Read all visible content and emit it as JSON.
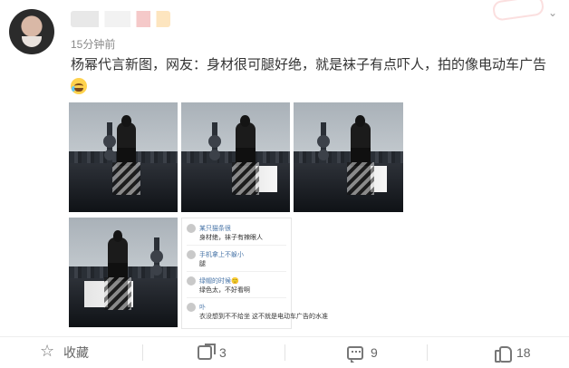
{
  "post": {
    "time": "15分钟前",
    "text": "杨幂代言新图，网友：身材很可腿好绝，就是袜子有点吓人，拍的像电动车广告",
    "images_count": 5,
    "comment_screenshot": {
      "rows": [
        {
          "name": "某只猫条很",
          "text": "身材绝，袜子有辣眼人"
        },
        {
          "name": "手机拿上不躲小",
          "text": "腿"
        },
        {
          "name": "绿帽的时候🙂",
          "text": "绿色太，不好看啊"
        },
        {
          "name": "卟",
          "text": "衣没想到不不给坐 这不就是电动车广告的水准"
        }
      ]
    }
  },
  "actions": {
    "favorite_label": "收藏",
    "share_count": "3",
    "comment_count": "9",
    "like_count": "18"
  },
  "icons": {
    "more": "chevron-down-icon",
    "favorite": "star-icon",
    "share": "share-icon",
    "comment": "comment-icon",
    "like": "thumb-up-icon",
    "emoji": "crying-laugh-emoji"
  }
}
